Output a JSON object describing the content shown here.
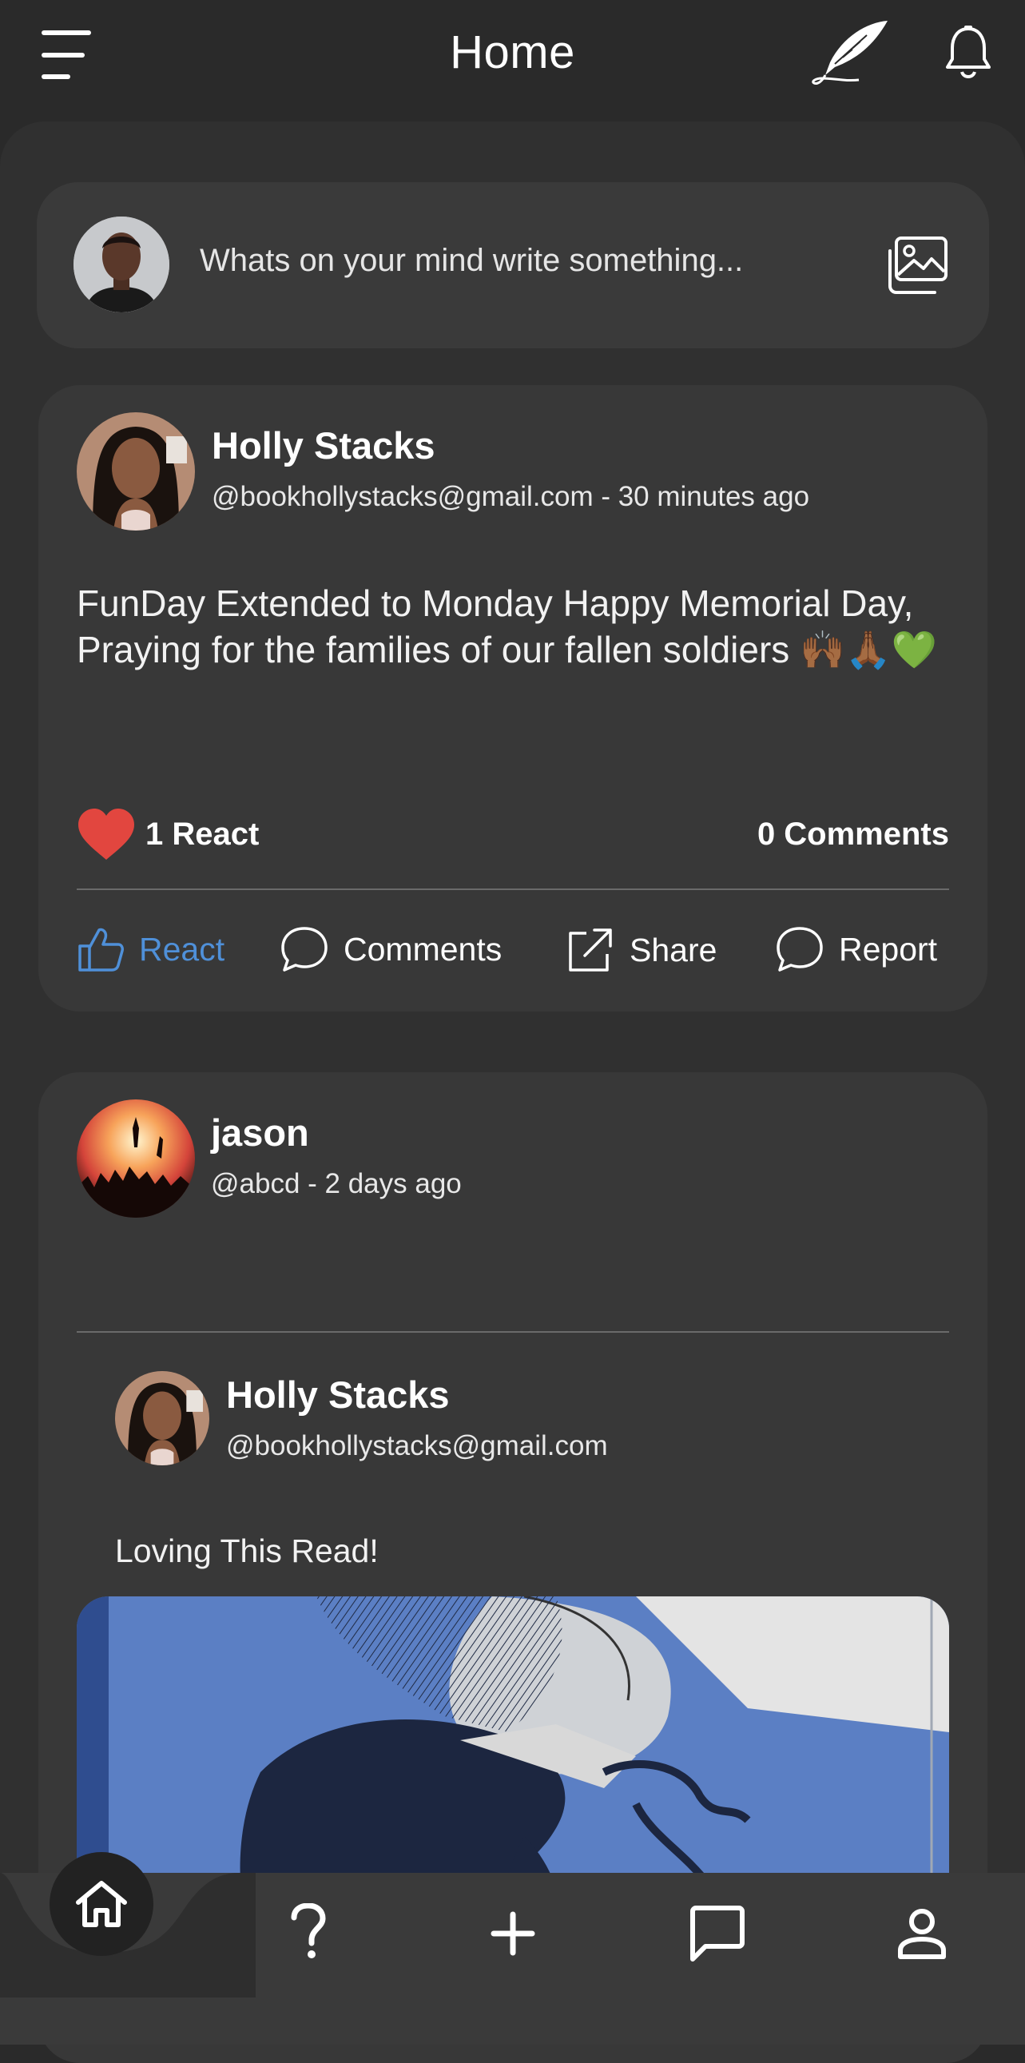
{
  "header": {
    "title": "Home"
  },
  "composer": {
    "placeholder": "Whats on your mind write something..."
  },
  "posts": [
    {
      "author": "Holly Stacks",
      "meta": "@bookhollystacks@gmail.com - 30 minutes ago",
      "text": "FunDay Extended to Monday Happy Memorial Day, Praying for the families of our fallen soldiers 🙌🏾🙏🏾💚",
      "react_count": "1 React",
      "comments_count": "0 Comments",
      "actions": {
        "react": "React",
        "comments": "Comments",
        "share": "Share",
        "report": "Report"
      }
    },
    {
      "author": "jason",
      "meta": "@abcd - 2 days ago",
      "shared": {
        "author": "Holly Stacks",
        "meta": "@bookhollystacks@gmail.com",
        "text": "Loving This Read!"
      }
    }
  ],
  "colors": {
    "accent": "#4f90d9",
    "heart": "#e2463f",
    "card": "#383838",
    "background": "#2a2a2a"
  },
  "icons": [
    "menu-icon",
    "quill-icon",
    "bell-icon",
    "image-icon",
    "heart-icon",
    "thumbs-up-icon",
    "comment-icon",
    "share-icon",
    "report-icon",
    "home-icon",
    "help-icon",
    "plus-icon",
    "chat-icon",
    "profile-icon"
  ]
}
